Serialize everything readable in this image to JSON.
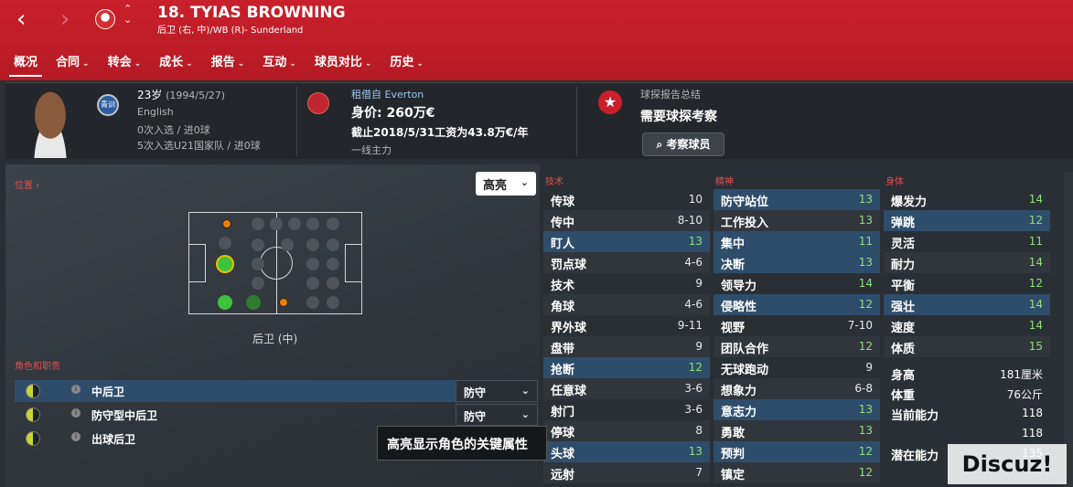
{
  "header": {
    "title": "18. TYIAS BROWNING",
    "subtitle": "后卫 (右, 中)/WB (R)- Sunderland",
    "tabs": [
      "概况",
      "合同",
      "转会",
      "成长",
      "报告",
      "互动",
      "球员对比",
      "历史"
    ]
  },
  "info": {
    "youth_badge": "青训",
    "age": "23岁",
    "dob": "(1994/5/27)",
    "nationality": "English",
    "caps_senior": "0次入选 / 进0球",
    "caps_u21": "5次入选U21国家队 / 进0球",
    "loan_prefix": "租借自",
    "loan_club": "Everton",
    "value": "身价: 260万€",
    "contract": "截止2018/5/31工资为43.8万€/年",
    "squad_status": "一线主力",
    "scout_title": "球探报告总结",
    "scout_need": "需要球探考察",
    "scout_button": "考察球员"
  },
  "left": {
    "position_label": "位置 ›",
    "highlight_label": "高亮",
    "position_name": "后卫 (中)",
    "roles_label": "角色和职责",
    "roles": [
      {
        "name": "中后卫",
        "duty": "防守"
      },
      {
        "name": "防守型中后卫",
        "duty": "防守"
      },
      {
        "name": "出球后卫",
        "duty": ""
      }
    ],
    "tooltip": "高亮显示角色的关键属性"
  },
  "attributes": {
    "technical_label": "技术",
    "mental_label": "精神",
    "physical_label": "身体",
    "technical": [
      {
        "name": "传球",
        "value": "10",
        "hl": false
      },
      {
        "name": "传中",
        "value": "8-10",
        "hl": false
      },
      {
        "name": "盯人",
        "value": "13",
        "hl": true
      },
      {
        "name": "罚点球",
        "value": "4-6",
        "hl": false
      },
      {
        "name": "技术",
        "value": "9",
        "hl": false
      },
      {
        "name": "角球",
        "value": "4-6",
        "hl": false
      },
      {
        "name": "界外球",
        "value": "9-11",
        "hl": false
      },
      {
        "name": "盘带",
        "value": "9",
        "hl": false
      },
      {
        "name": "抢断",
        "value": "12",
        "hl": true
      },
      {
        "name": "任意球",
        "value": "3-6",
        "hl": false
      },
      {
        "name": "射门",
        "value": "3-6",
        "hl": false
      },
      {
        "name": "停球",
        "value": "8",
        "hl": false
      },
      {
        "name": "头球",
        "value": "13",
        "hl": true
      },
      {
        "name": "远射",
        "value": "7",
        "hl": false
      }
    ],
    "mental": [
      {
        "name": "防守站位",
        "value": "13",
        "hl": true
      },
      {
        "name": "工作投入",
        "value": "13",
        "hl": false
      },
      {
        "name": "集中",
        "value": "11",
        "hl": true
      },
      {
        "name": "决断",
        "value": "13",
        "hl": true
      },
      {
        "name": "领导力",
        "value": "14",
        "hl": false
      },
      {
        "name": "侵略性",
        "value": "12",
        "hl": true
      },
      {
        "name": "视野",
        "value": "7-10",
        "hl": false
      },
      {
        "name": "团队合作",
        "value": "12",
        "hl": false
      },
      {
        "name": "无球跑动",
        "value": "9",
        "hl": false
      },
      {
        "name": "想象力",
        "value": "6-8",
        "hl": false
      },
      {
        "name": "意志力",
        "value": "13",
        "hl": true
      },
      {
        "name": "勇敢",
        "value": "13",
        "hl": false
      },
      {
        "name": "预判",
        "value": "12",
        "hl": true
      },
      {
        "name": "镇定",
        "value": "12",
        "hl": false
      }
    ],
    "physical": [
      {
        "name": "爆发力",
        "value": "14",
        "hl": false
      },
      {
        "name": "弹跳",
        "value": "12",
        "hl": true
      },
      {
        "name": "灵活",
        "value": "11",
        "hl": false
      },
      {
        "name": "耐力",
        "value": "14",
        "hl": false
      },
      {
        "name": "平衡",
        "value": "12",
        "hl": false
      },
      {
        "name": "强壮",
        "value": "14",
        "hl": true
      },
      {
        "name": "速度",
        "value": "14",
        "hl": false
      },
      {
        "name": "体质",
        "value": "15",
        "hl": false
      }
    ],
    "extras": [
      {
        "name": "身高",
        "value": "181厘米"
      },
      {
        "name": "体重",
        "value": "76公斤"
      },
      {
        "name": "当前能力",
        "value": "118"
      },
      {
        "name": "",
        "value": "118"
      },
      {
        "name": "潜在能力",
        "value": "135"
      }
    ]
  },
  "watermark": "Discuz!"
}
